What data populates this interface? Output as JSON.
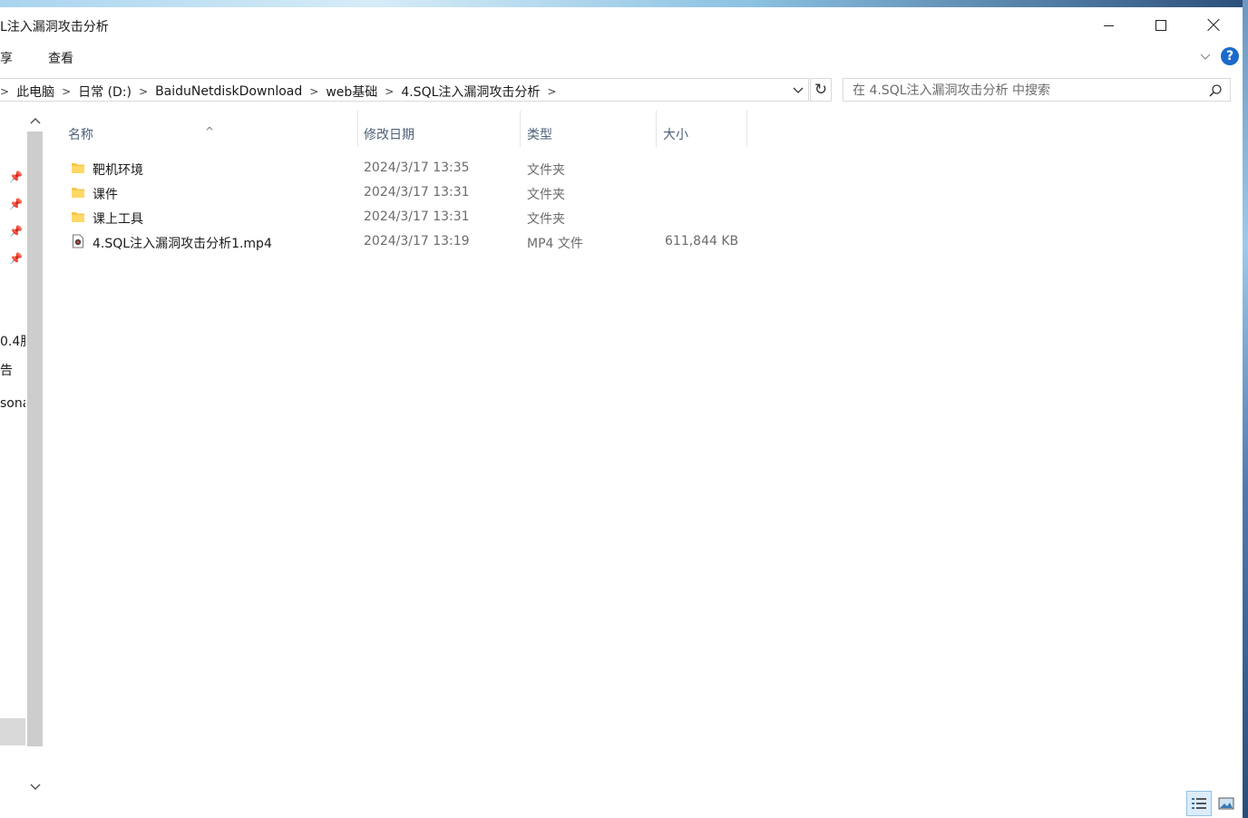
{
  "window": {
    "title": "L注入漏洞攻击分析"
  },
  "ribbon": {
    "tabs": [
      "享",
      "查看"
    ],
    "help": "?"
  },
  "address": {
    "crumbs": [
      "此电脑",
      "日常 (D:)",
      "BaiduNetdiskDownload",
      "web基础",
      "4.SQL注入漏洞攻击分析"
    ],
    "search_placeholder": "在 4.SQL注入漏洞攻击分析 中搜索"
  },
  "nav": {
    "truncated_items": [
      "0.4肌",
      "告",
      "sona"
    ]
  },
  "columns": {
    "name": "名称",
    "date": "修改日期",
    "type": "类型",
    "size": "大小",
    "sort_caret": "^"
  },
  "files": [
    {
      "name": "靶机环境",
      "date": "2024/3/17 13:35",
      "type": "文件夹",
      "size": "",
      "icon": "folder-icon"
    },
    {
      "name": "课件",
      "date": "2024/3/17 13:31",
      "type": "文件夹",
      "size": "",
      "icon": "folder-icon"
    },
    {
      "name": "课上工具",
      "date": "2024/3/17 13:31",
      "type": "文件夹",
      "size": "",
      "icon": "folder-icon"
    },
    {
      "name": "4.SQL注入漏洞攻击分析1.mp4",
      "date": "2024/3/17 13:19",
      "type": "MP4 文件",
      "size": "611,844 KB",
      "icon": "video-file-icon"
    }
  ],
  "colors": {
    "accent": "#1b6ac9",
    "folder": "#f4c64c",
    "header_text": "#4c607a"
  }
}
